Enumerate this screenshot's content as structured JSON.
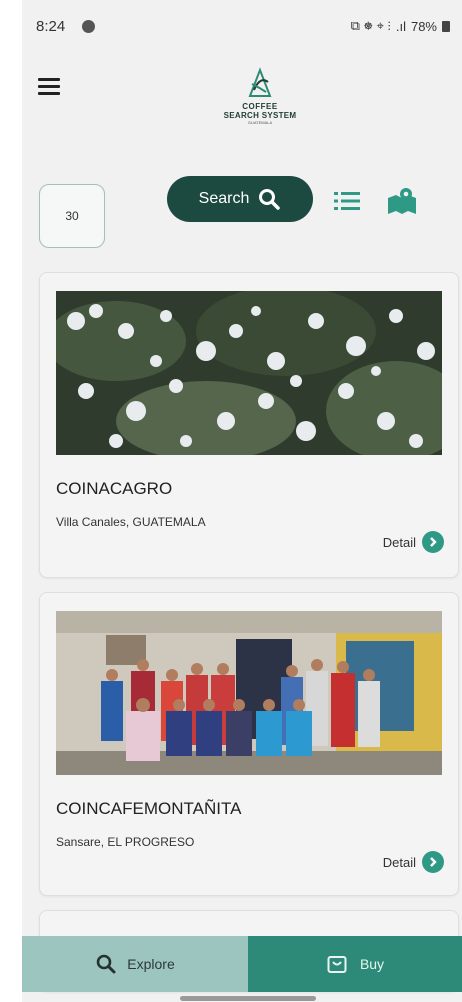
{
  "status_bar": {
    "time": "8:24",
    "right_icons": "⧉ ☸ ⌖ ⫶",
    "signal": ".ıl",
    "battery": "78%"
  },
  "app": {
    "logo_line1": "COFFEE",
    "logo_line2": "SEARCH SYSTEM",
    "logo_line3": "GUATEMALA"
  },
  "toolbar": {
    "count_value": "30",
    "search_label": "Search"
  },
  "results": [
    {
      "title": "COINACAGRO",
      "location": "Villa Canales, GUATEMALA",
      "detail_label": "Detail",
      "image": "coffee-blossoms-photo"
    },
    {
      "title": "COINCAFEMONTAÑITA",
      "location": "Sansare, EL PROGRESO",
      "detail_label": "Detail",
      "image": "cooperative-group-photo"
    }
  ],
  "bottom_nav": {
    "explore_label": "Explore",
    "buy_label": "Buy"
  },
  "colors": {
    "primary_dark": "#1c4a40",
    "accent": "#2e9a86",
    "nav_explore": "#9cc5c0",
    "nav_buy": "#2d8a78"
  }
}
